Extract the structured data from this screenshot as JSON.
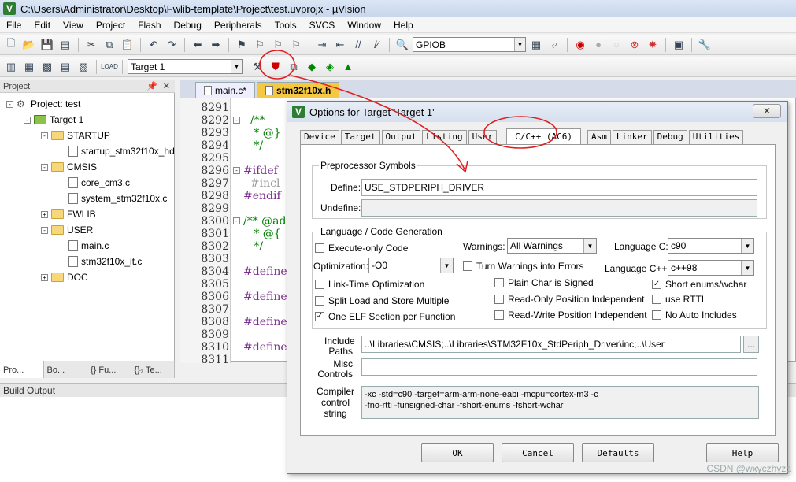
{
  "window": {
    "title": "C:\\Users\\Administrator\\Desktop\\Fwlib-template\\Project\\test.uvprojx - µVision"
  },
  "menu": [
    "File",
    "Edit",
    "View",
    "Project",
    "Flash",
    "Debug",
    "Peripherals",
    "Tools",
    "SVCS",
    "Window",
    "Help"
  ],
  "toolbar": {
    "find_value": "GPIOB",
    "target_value": "Target 1"
  },
  "project_panel": {
    "header": "Project",
    "tree": [
      {
        "label": "Project: test",
        "level": 0,
        "type": "project",
        "exp": "-"
      },
      {
        "label": "Target 1",
        "level": 1,
        "type": "target",
        "exp": "-"
      },
      {
        "label": "STARTUP",
        "level": 2,
        "type": "folder",
        "exp": "-"
      },
      {
        "label": "startup_stm32f10x_hd",
        "level": 3,
        "type": "file",
        "exp": ""
      },
      {
        "label": "CMSIS",
        "level": 2,
        "type": "folder",
        "exp": "-"
      },
      {
        "label": "core_cm3.c",
        "level": 3,
        "type": "file",
        "exp": ""
      },
      {
        "label": "system_stm32f10x.c",
        "level": 3,
        "type": "file",
        "exp": ""
      },
      {
        "label": "FWLIB",
        "level": 2,
        "type": "folder",
        "exp": "+"
      },
      {
        "label": "USER",
        "level": 2,
        "type": "folder",
        "exp": "-"
      },
      {
        "label": "main.c",
        "level": 3,
        "type": "file",
        "exp": ""
      },
      {
        "label": "stm32f10x_it.c",
        "level": 3,
        "type": "file",
        "exp": ""
      },
      {
        "label": "DOC",
        "level": 2,
        "type": "folder",
        "exp": "+"
      }
    ],
    "tabs": [
      "Pro...",
      "Bo...",
      "{} Fu...",
      "{}₂ Te..."
    ]
  },
  "editor": {
    "tabs": [
      "main.c*",
      "stm32f10x.h"
    ],
    "lines": [
      {
        "n": "8291",
        "fold": "",
        "text": "",
        "cls": ""
      },
      {
        "n": "8292",
        "fold": "-",
        "text": "  /**",
        "cls": "cmt"
      },
      {
        "n": "8293",
        "fold": "",
        "text": "   * @}",
        "cls": "cmt"
      },
      {
        "n": "8294",
        "fold": "",
        "text": "   */",
        "cls": "cmt"
      },
      {
        "n": "8295",
        "fold": "",
        "text": "",
        "cls": ""
      },
      {
        "n": "8296",
        "fold": "-",
        "text": "#ifdef",
        "cls": "pre"
      },
      {
        "n": "8297",
        "fold": "",
        "text": "  #incl",
        "cls": "pre2"
      },
      {
        "n": "8298",
        "fold": "",
        "text": "#endif",
        "cls": "pre"
      },
      {
        "n": "8299",
        "fold": "",
        "text": "",
        "cls": ""
      },
      {
        "n": "8300",
        "fold": "-",
        "text": "/** @ad",
        "cls": "cmt"
      },
      {
        "n": "8301",
        "fold": "",
        "text": "   * @{",
        "cls": "cmt"
      },
      {
        "n": "8302",
        "fold": "",
        "text": "   */",
        "cls": "cmt"
      },
      {
        "n": "8303",
        "fold": "",
        "text": "",
        "cls": ""
      },
      {
        "n": "8304",
        "fold": "",
        "text": "#define",
        "cls": "pre"
      },
      {
        "n": "8305",
        "fold": "",
        "text": "",
        "cls": ""
      },
      {
        "n": "8306",
        "fold": "",
        "text": "#define",
        "cls": "pre"
      },
      {
        "n": "8307",
        "fold": "",
        "text": "",
        "cls": ""
      },
      {
        "n": "8308",
        "fold": "",
        "text": "#define",
        "cls": "pre"
      },
      {
        "n": "8309",
        "fold": "",
        "text": "",
        "cls": ""
      },
      {
        "n": "8310",
        "fold": "",
        "text": "#define",
        "cls": "pre"
      },
      {
        "n": "8311",
        "fold": "",
        "text": "",
        "cls": ""
      }
    ]
  },
  "build_output": {
    "header": "Build Output"
  },
  "dialog": {
    "title": "Options for Target 'Target 1'",
    "close": "✕",
    "tabs": [
      "Device",
      "Target",
      "Output",
      "Listing",
      "User",
      "C/C++ (AC6)",
      "Asm",
      "Linker",
      "Debug",
      "Utilities"
    ],
    "active_tab": "C/C++ (AC6)",
    "preprocessor": {
      "legend": "Preprocessor Symbols",
      "define_label": "Define:",
      "define_value": "USE_STDPERIPH_DRIVER",
      "undefine_label": "Undefine:",
      "undefine_value": ""
    },
    "language": {
      "legend": "Language / Code Generation",
      "execute_only": "Execute-only Code",
      "optimization_label": "Optimization:",
      "optimization_value": "-O0",
      "warnings_label": "Warnings:",
      "warnings_value": "All Warnings",
      "turn_warnings": "Turn Warnings into Errors",
      "language_c_label": "Language C:",
      "language_c_value": "c90",
      "language_cpp_label": "Language C++:",
      "language_cpp_value": "c++98",
      "lto": "Link-Time Optimization",
      "split_load": "Split Load and Store Multiple",
      "one_elf": "One ELF Section per Function",
      "plain_char": "Plain Char is Signed",
      "ro_pos": "Read-Only Position Independent",
      "rw_pos": "Read-Write Position Independent",
      "short_enums": "Short enums/wchar",
      "use_rtti": "use RTTI",
      "no_auto": "No Auto Includes",
      "check": "✓"
    },
    "include_label_1": "Include",
    "include_label_2": "Paths",
    "include_value": "..\\Libraries\\CMSIS;..\\Libraries\\STM32F10x_StdPeriph_Driver\\inc;..\\User",
    "browse": "...",
    "misc_label_1": "Misc",
    "misc_label_2": "Controls",
    "misc_value": "",
    "compiler_label_1": "Compiler",
    "compiler_label_2": "control",
    "compiler_label_3": "string",
    "compiler_line_1": "-xc -std=c90 -target=arm-arm-none-eabi -mcpu=cortex-m3 -c",
    "compiler_line_2": "-fno-rtti -funsigned-char -fshort-enums -fshort-wchar",
    "buttons": {
      "ok": "OK",
      "cancel": "Cancel",
      "defaults": "Defaults",
      "help": "Help"
    }
  },
  "watermark": "CSDN @wxyczhyza",
  "colors": {
    "annotation": "#e02020",
    "active_tab": "#f5c842"
  }
}
